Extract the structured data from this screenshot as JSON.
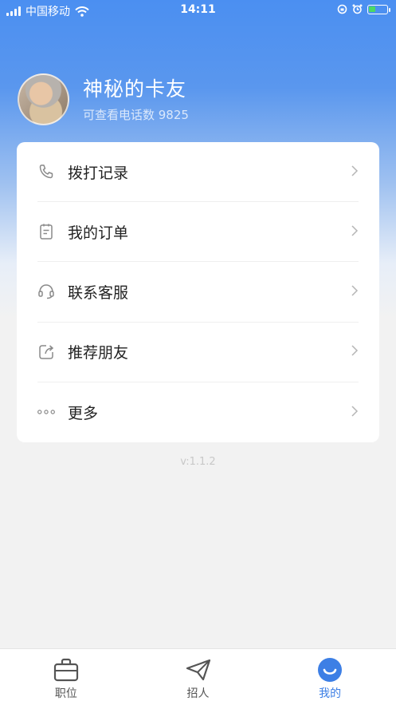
{
  "status_bar": {
    "carrier": "中国移动",
    "time": "14:11"
  },
  "profile": {
    "name": "神秘的卡友",
    "phone_count_label": "可查看电话数 9825"
  },
  "menu": {
    "items": [
      {
        "label": "拨打记录",
        "icon": "phone-icon"
      },
      {
        "label": "我的订单",
        "icon": "order-icon"
      },
      {
        "label": "联系客服",
        "icon": "headset-icon"
      },
      {
        "label": "推荐朋友",
        "icon": "share-icon"
      },
      {
        "label": "更多",
        "icon": "more-icon"
      }
    ]
  },
  "version": "v:1.1.2",
  "tabbar": {
    "tabs": [
      {
        "label": "职位",
        "icon": "briefcase-icon",
        "active": false
      },
      {
        "label": "招人",
        "icon": "paper-plane-icon",
        "active": false
      },
      {
        "label": "我的",
        "icon": "smile-icon",
        "active": true
      }
    ]
  },
  "colors": {
    "primary": "#3d7fe5",
    "header_gradient_top": "#4b8ff1",
    "page_bg": "#f2f2f2"
  }
}
